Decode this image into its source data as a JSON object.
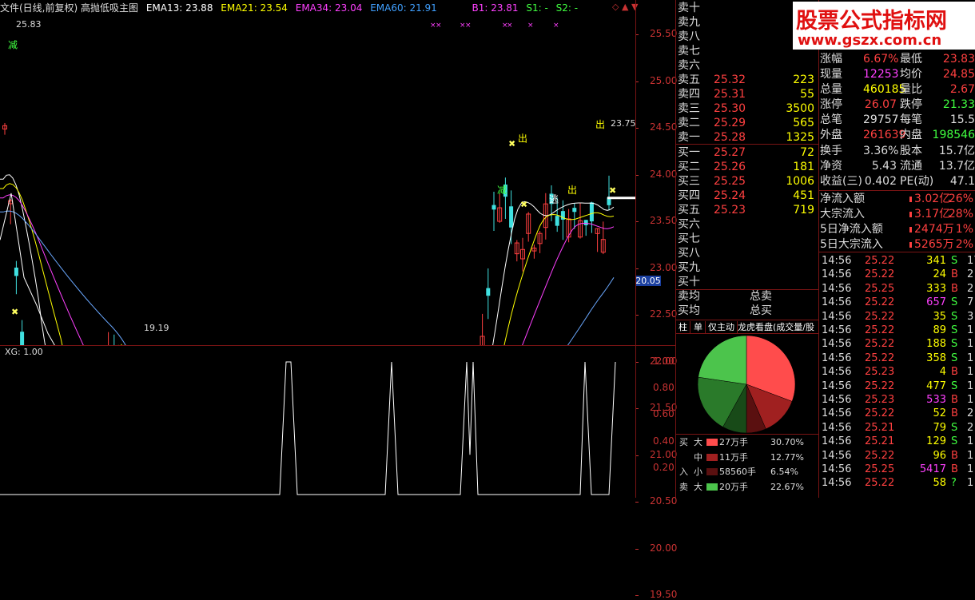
{
  "topbar": {
    "title": "文件(日线,前复权) 高抛低吸主图",
    "ema13": "EMA13: 23.88",
    "ema21": "EMA21: 23.54",
    "ema34": "EMA34: 23.04",
    "ema60": "EMA60: 21.91",
    "b1": "B1: 23.81",
    "s1": "S1: -",
    "s2": "S2: -",
    "colors": {
      "ema13": "#ffffff",
      "ema21": "#ffff00",
      "ema34": "#ff40ff",
      "ema60": "#40a0ff",
      "b1": "#ff40ff",
      "s1": "#40ff40"
    }
  },
  "watermark": {
    "title": "股票公式指标网",
    "url": "www.gszx.com.cn"
  },
  "kchart": {
    "yaxis_labels": [
      "25.50",
      "25.00",
      "24.50",
      "24.00",
      "23.50",
      "23.00",
      "22.50",
      "22.00",
      "21.50",
      "21.00",
      "20.50",
      "20.00",
      "19.50"
    ],
    "high_label": "25.83",
    "low_label": "19.19",
    "last_label": "23.75",
    "cursor_price": "20.05",
    "marks": {
      "out": "出",
      "escape": "逃",
      "enter": "进",
      "reduce": "减",
      "break": "破",
      "dollar": "$"
    }
  },
  "xg": {
    "label": "XG: 1.00",
    "yaxis_labels": [
      "1.00",
      "0.80",
      "0.60",
      "0.40",
      "0.20"
    ]
  },
  "orderbook": {
    "sells": [
      {
        "label": "卖十",
        "price": "",
        "vol": ""
      },
      {
        "label": "卖九",
        "price": "",
        "vol": ""
      },
      {
        "label": "卖八",
        "price": "",
        "vol": ""
      },
      {
        "label": "卖七",
        "price": "",
        "vol": ""
      },
      {
        "label": "卖六",
        "price": "",
        "vol": ""
      },
      {
        "label": "卖五",
        "price": "25.32",
        "vol": "223"
      },
      {
        "label": "卖四",
        "price": "25.31",
        "vol": "55"
      },
      {
        "label": "卖三",
        "price": "25.30",
        "vol": "3500"
      },
      {
        "label": "卖二",
        "price": "25.29",
        "vol": "565"
      },
      {
        "label": "卖一",
        "price": "25.28",
        "vol": "1325"
      }
    ],
    "buys": [
      {
        "label": "买一",
        "price": "25.27",
        "vol": "72"
      },
      {
        "label": "买二",
        "price": "25.26",
        "vol": "181"
      },
      {
        "label": "买三",
        "price": "25.25",
        "vol": "1006"
      },
      {
        "label": "买四",
        "price": "25.24",
        "vol": "451"
      },
      {
        "label": "买五",
        "price": "25.23",
        "vol": "719"
      },
      {
        "label": "买六",
        "price": "",
        "vol": ""
      },
      {
        "label": "买七",
        "price": "",
        "vol": ""
      },
      {
        "label": "买八",
        "price": "",
        "vol": ""
      },
      {
        "label": "买九",
        "price": "",
        "vol": ""
      },
      {
        "label": "买十",
        "price": "",
        "vol": ""
      }
    ],
    "avg_sell": "卖均",
    "total_sell": "总卖",
    "avg_buy": "买均",
    "total_buy": "总买"
  },
  "tabs": [
    "柱",
    "单",
    "仅主动",
    "龙虎看盘(成交量/股"
  ],
  "pie": {
    "slices": [
      {
        "name": "买大",
        "value": 30.7,
        "color": "#ff4c4c"
      },
      {
        "name": "买中",
        "value": 12.77,
        "color": "#a02020"
      },
      {
        "name": "买小",
        "value": 6.54,
        "color": "#5a1010"
      },
      {
        "name": "卖小",
        "value": 8.0,
        "color": "#184a18"
      },
      {
        "name": "卖中",
        "value": 19.32,
        "color": "#2a7a2a"
      },
      {
        "name": "卖大",
        "value": 22.67,
        "color": "#4cc44c"
      }
    ]
  },
  "flow_legend": [
    {
      "side": "买",
      "size": "大",
      "amount": "27万手",
      "pct": "30.70%",
      "color": "#ff4c4c"
    },
    {
      "side": "",
      "size": "中",
      "amount": "11万手",
      "pct": "12.77%",
      "color": "#a02020"
    },
    {
      "side": "入",
      "size": "小",
      "amount": "58560手",
      "pct": "6.54%",
      "color": "#5a1010"
    },
    {
      "side": "卖",
      "size": "大",
      "amount": "20万手",
      "pct": "22.67%",
      "color": "#4cc44c"
    }
  ],
  "quote": [
    {
      "l1": "涨幅",
      "v1": "6.67%",
      "c1": "#ff4040",
      "l2": "最低",
      "v2": "23.83",
      "c2": "#ff4040"
    },
    {
      "l1": "现量",
      "v1": "12253",
      "c1": "#ff40ff",
      "l2": "均价",
      "v2": "24.85",
      "c2": "#ff4040"
    },
    {
      "l1": "总量",
      "v1": "460185",
      "c1": "#ffff00",
      "l2": "量比",
      "v2": "2.67",
      "c2": "#ff4040"
    },
    {
      "l1": "涨停",
      "v1": "26.07",
      "c1": "#ff4040",
      "l2": "跌停",
      "v2": "21.33",
      "c2": "#40ff40"
    },
    {
      "l1": "总笔",
      "v1": "29757",
      "c1": "#dddddd",
      "l2": "每笔",
      "v2": "15.5",
      "c2": "#dddddd"
    },
    {
      "l1": "外盘",
      "v1": "261639",
      "c1": "#ff4040",
      "l2": "内盘",
      "v2": "198546",
      "c2": "#40ff40"
    },
    {
      "l1": "换手",
      "v1": "3.36%",
      "c1": "#dddddd",
      "l2": "股本",
      "v2": "15.7亿",
      "c2": "#dddddd"
    },
    {
      "l1": "净资",
      "v1": "5.43",
      "c1": "#dddddd",
      "l2": "流通",
      "v2": "13.7亿",
      "c2": "#dddddd"
    },
    {
      "l1": "收益(三)",
      "v1": "0.402",
      "c1": "#dddddd",
      "l2": "PE(动)",
      "v2": "47.1",
      "c2": "#dddddd"
    }
  ],
  "capital": [
    {
      "label": "净流入额",
      "value": "3.02亿",
      "pct": "26%"
    },
    {
      "label": "大宗流入",
      "value": "3.17亿",
      "pct": "28%"
    },
    {
      "label": "5日净流入额",
      "value": "2474万",
      "pct": "1%"
    },
    {
      "label": "5日大宗流入",
      "value": "5265万",
      "pct": "2%"
    }
  ],
  "ticks": [
    {
      "t": "14:56",
      "p": "25.22",
      "v": "341",
      "d": "S",
      "n": "17"
    },
    {
      "t": "14:56",
      "p": "25.22",
      "v": "24",
      "d": "B",
      "n": "2"
    },
    {
      "t": "14:56",
      "p": "25.25",
      "v": "333",
      "d": "B",
      "n": "2"
    },
    {
      "t": "14:56",
      "p": "25.22",
      "v": "657",
      "d": "S",
      "n": "7"
    },
    {
      "t": "14:56",
      "p": "25.22",
      "v": "35",
      "d": "S",
      "n": "3"
    },
    {
      "t": "14:56",
      "p": "25.22",
      "v": "89",
      "d": "S",
      "n": "1"
    },
    {
      "t": "14:56",
      "p": "25.22",
      "v": "188",
      "d": "S",
      "n": "1"
    },
    {
      "t": "14:56",
      "p": "25.22",
      "v": "358",
      "d": "S",
      "n": "1"
    },
    {
      "t": "14:56",
      "p": "25.23",
      "v": "4",
      "d": "B",
      "n": "1"
    },
    {
      "t": "14:56",
      "p": "25.22",
      "v": "477",
      "d": "S",
      "n": "1"
    },
    {
      "t": "14:56",
      "p": "25.23",
      "v": "533",
      "d": "B",
      "n": "1"
    },
    {
      "t": "14:56",
      "p": "25.22",
      "v": "52",
      "d": "B",
      "n": "2"
    },
    {
      "t": "14:56",
      "p": "25.21",
      "v": "79",
      "d": "S",
      "n": "2"
    },
    {
      "t": "14:56",
      "p": "25.21",
      "v": "129",
      "d": "S",
      "n": "1"
    },
    {
      "t": "14:56",
      "p": "25.22",
      "v": "96",
      "d": "B",
      "n": "1"
    },
    {
      "t": "14:56",
      "p": "25.25",
      "v": "5417",
      "d": "B",
      "n": "1"
    },
    {
      "t": "14:56",
      "p": "25.22",
      "v": "58",
      "d": "?",
      "n": "1"
    }
  ]
}
